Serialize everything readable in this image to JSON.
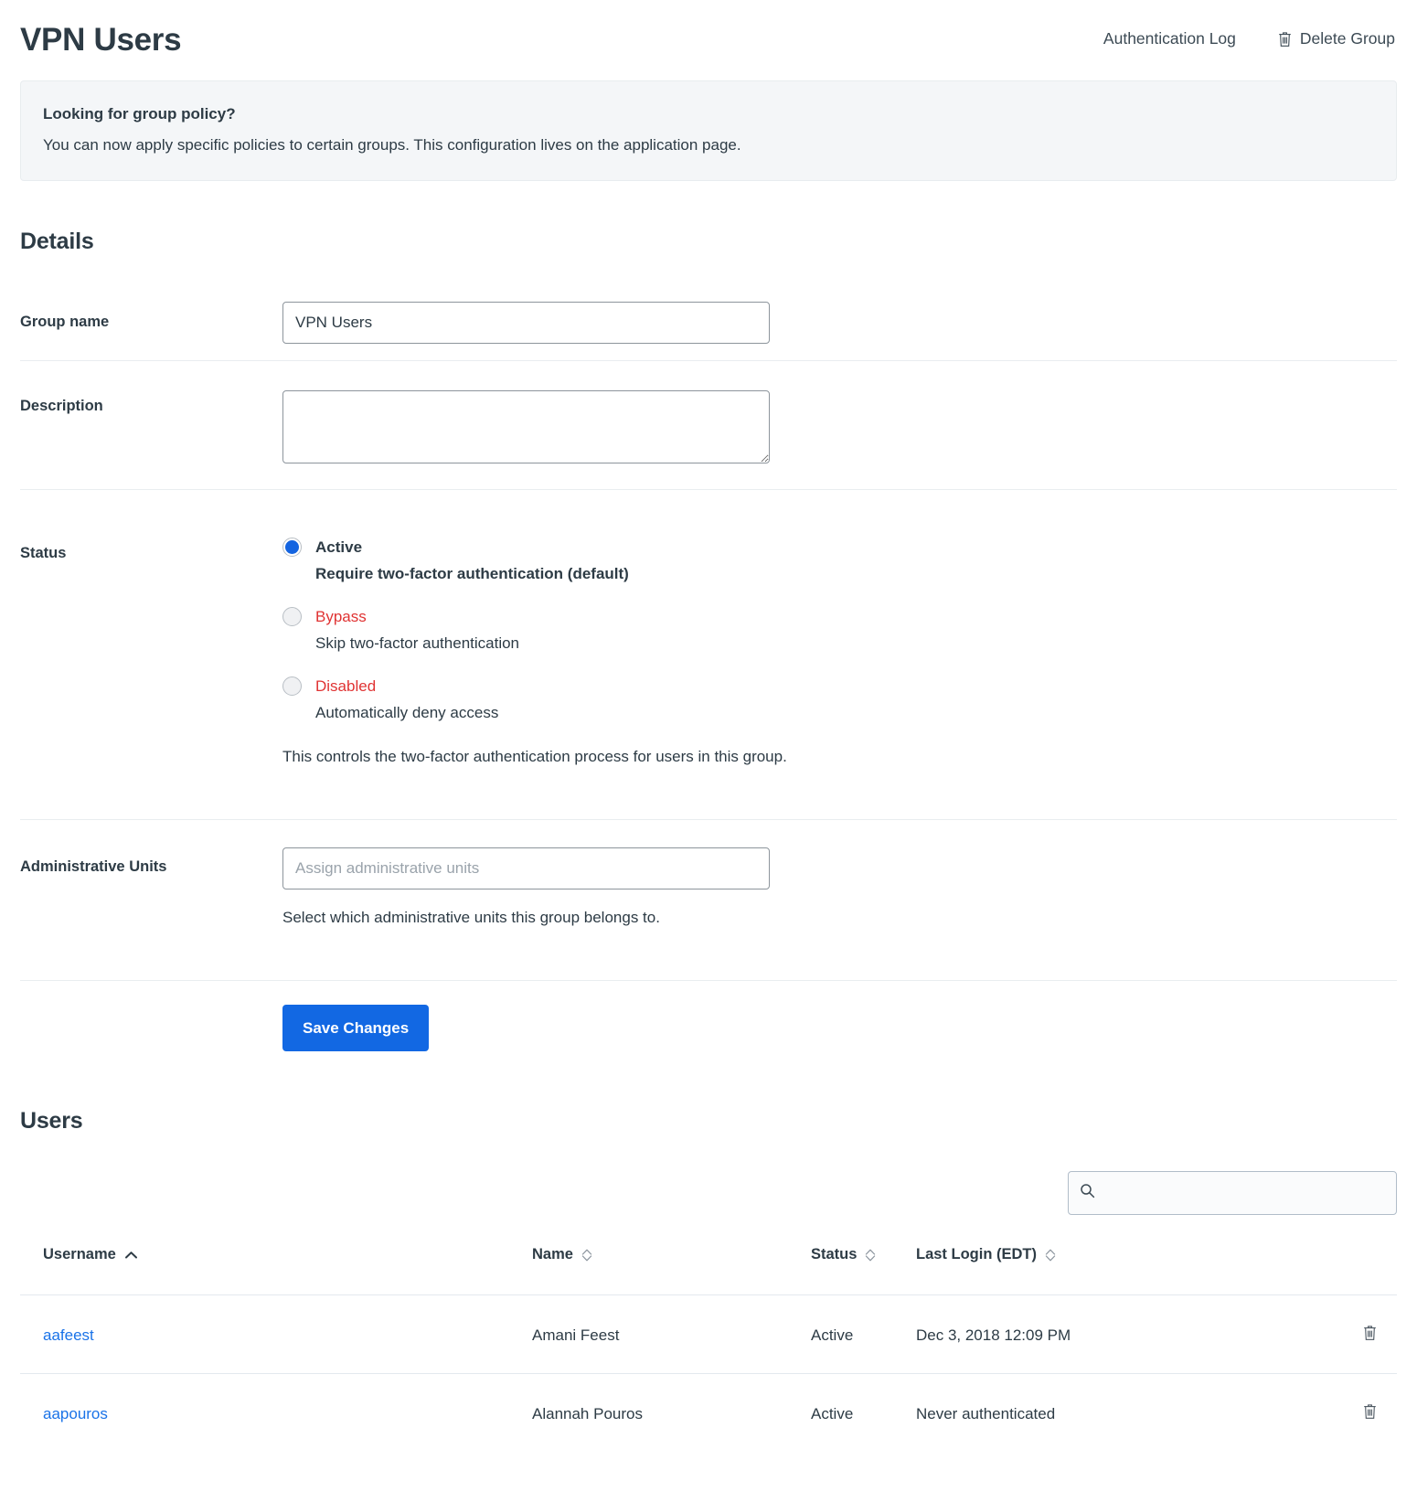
{
  "header": {
    "title": "VPN Users",
    "auth_log_label": "Authentication Log",
    "delete_group_label": "Delete Group",
    "delete_icon": "trash-icon"
  },
  "info_banner": {
    "title": "Looking for group policy?",
    "text": "You can now apply specific policies to certain groups. This configuration lives on the application page."
  },
  "details": {
    "heading": "Details",
    "group_name": {
      "label": "Group name",
      "value": "VPN Users",
      "placeholder": ""
    },
    "description": {
      "label": "Description",
      "value": "",
      "placeholder": ""
    },
    "status": {
      "label": "Status",
      "selected": "Active",
      "options": [
        {
          "label": "Active",
          "sub": "Require two-factor authentication (default)",
          "selected": true,
          "tone": "default"
        },
        {
          "label": "Bypass",
          "sub": "Skip two-factor authentication",
          "selected": false,
          "tone": "danger"
        },
        {
          "label": "Disabled",
          "sub": "Automatically deny access",
          "selected": false,
          "tone": "danger"
        }
      ],
      "hint": "This controls the two-factor authentication process for users in this group."
    },
    "administrative_units": {
      "label": "Administrative Units",
      "value": "",
      "placeholder": "Assign administrative units",
      "hint": "Select which administrative units this group belongs to."
    },
    "save_label": "Save Changes"
  },
  "users": {
    "heading": "Users",
    "search": {
      "value": "",
      "placeholder": "",
      "icon": "search-icon"
    },
    "columns": [
      {
        "label": "Username",
        "sort": "asc"
      },
      {
        "label": "Name",
        "sort": "none"
      },
      {
        "label": "Status",
        "sort": "none"
      },
      {
        "label": "Last Login (EDT)",
        "sort": "none"
      },
      {
        "label": "",
        "sort": ""
      }
    ],
    "rows": [
      {
        "username": "aafeest",
        "name": "Amani Feest",
        "status": "Active",
        "last_login": "Dec 3, 2018 12:09 PM",
        "delete_icon": "trash-icon"
      },
      {
        "username": "aapouros",
        "name": "Alannah Pouros",
        "status": "Active",
        "last_login": "Never authenticated",
        "delete_icon": "trash-icon"
      }
    ]
  },
  "colors": {
    "accent_blue": "#1268e3",
    "link_blue": "#1a73e8",
    "danger_red": "#e03333",
    "text": "#2d3b45",
    "banner_bg": "#f4f6f8"
  }
}
